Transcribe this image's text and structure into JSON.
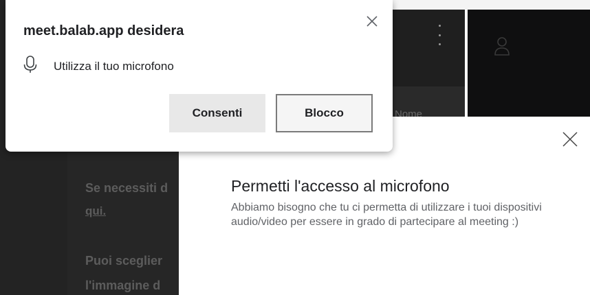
{
  "background": {
    "text_line_1": "Se necessiti d",
    "link": "qui",
    "link_suffix": ".",
    "text_line_3": "Puoi sceglier",
    "text_line_4": "l'immagine d",
    "card_text": "Nome"
  },
  "permission_prompt": {
    "title": "meet.balab.app desidera",
    "request_text": "Utilizza il tuo microfono",
    "allow_label": "Consenti",
    "block_label": "Blocco"
  },
  "modal": {
    "title": "Permetti l'accesso al microfono",
    "body": "Abbiamo bisogno che tu ci permetta di utilizzare i tuoi dispositivi audio/video per essere in grado di partecipare al meeting :)"
  },
  "icons": {
    "mic": "microphone-icon",
    "close": "close-icon",
    "menu": "kebab-menu-icon",
    "user": "user-icon"
  }
}
